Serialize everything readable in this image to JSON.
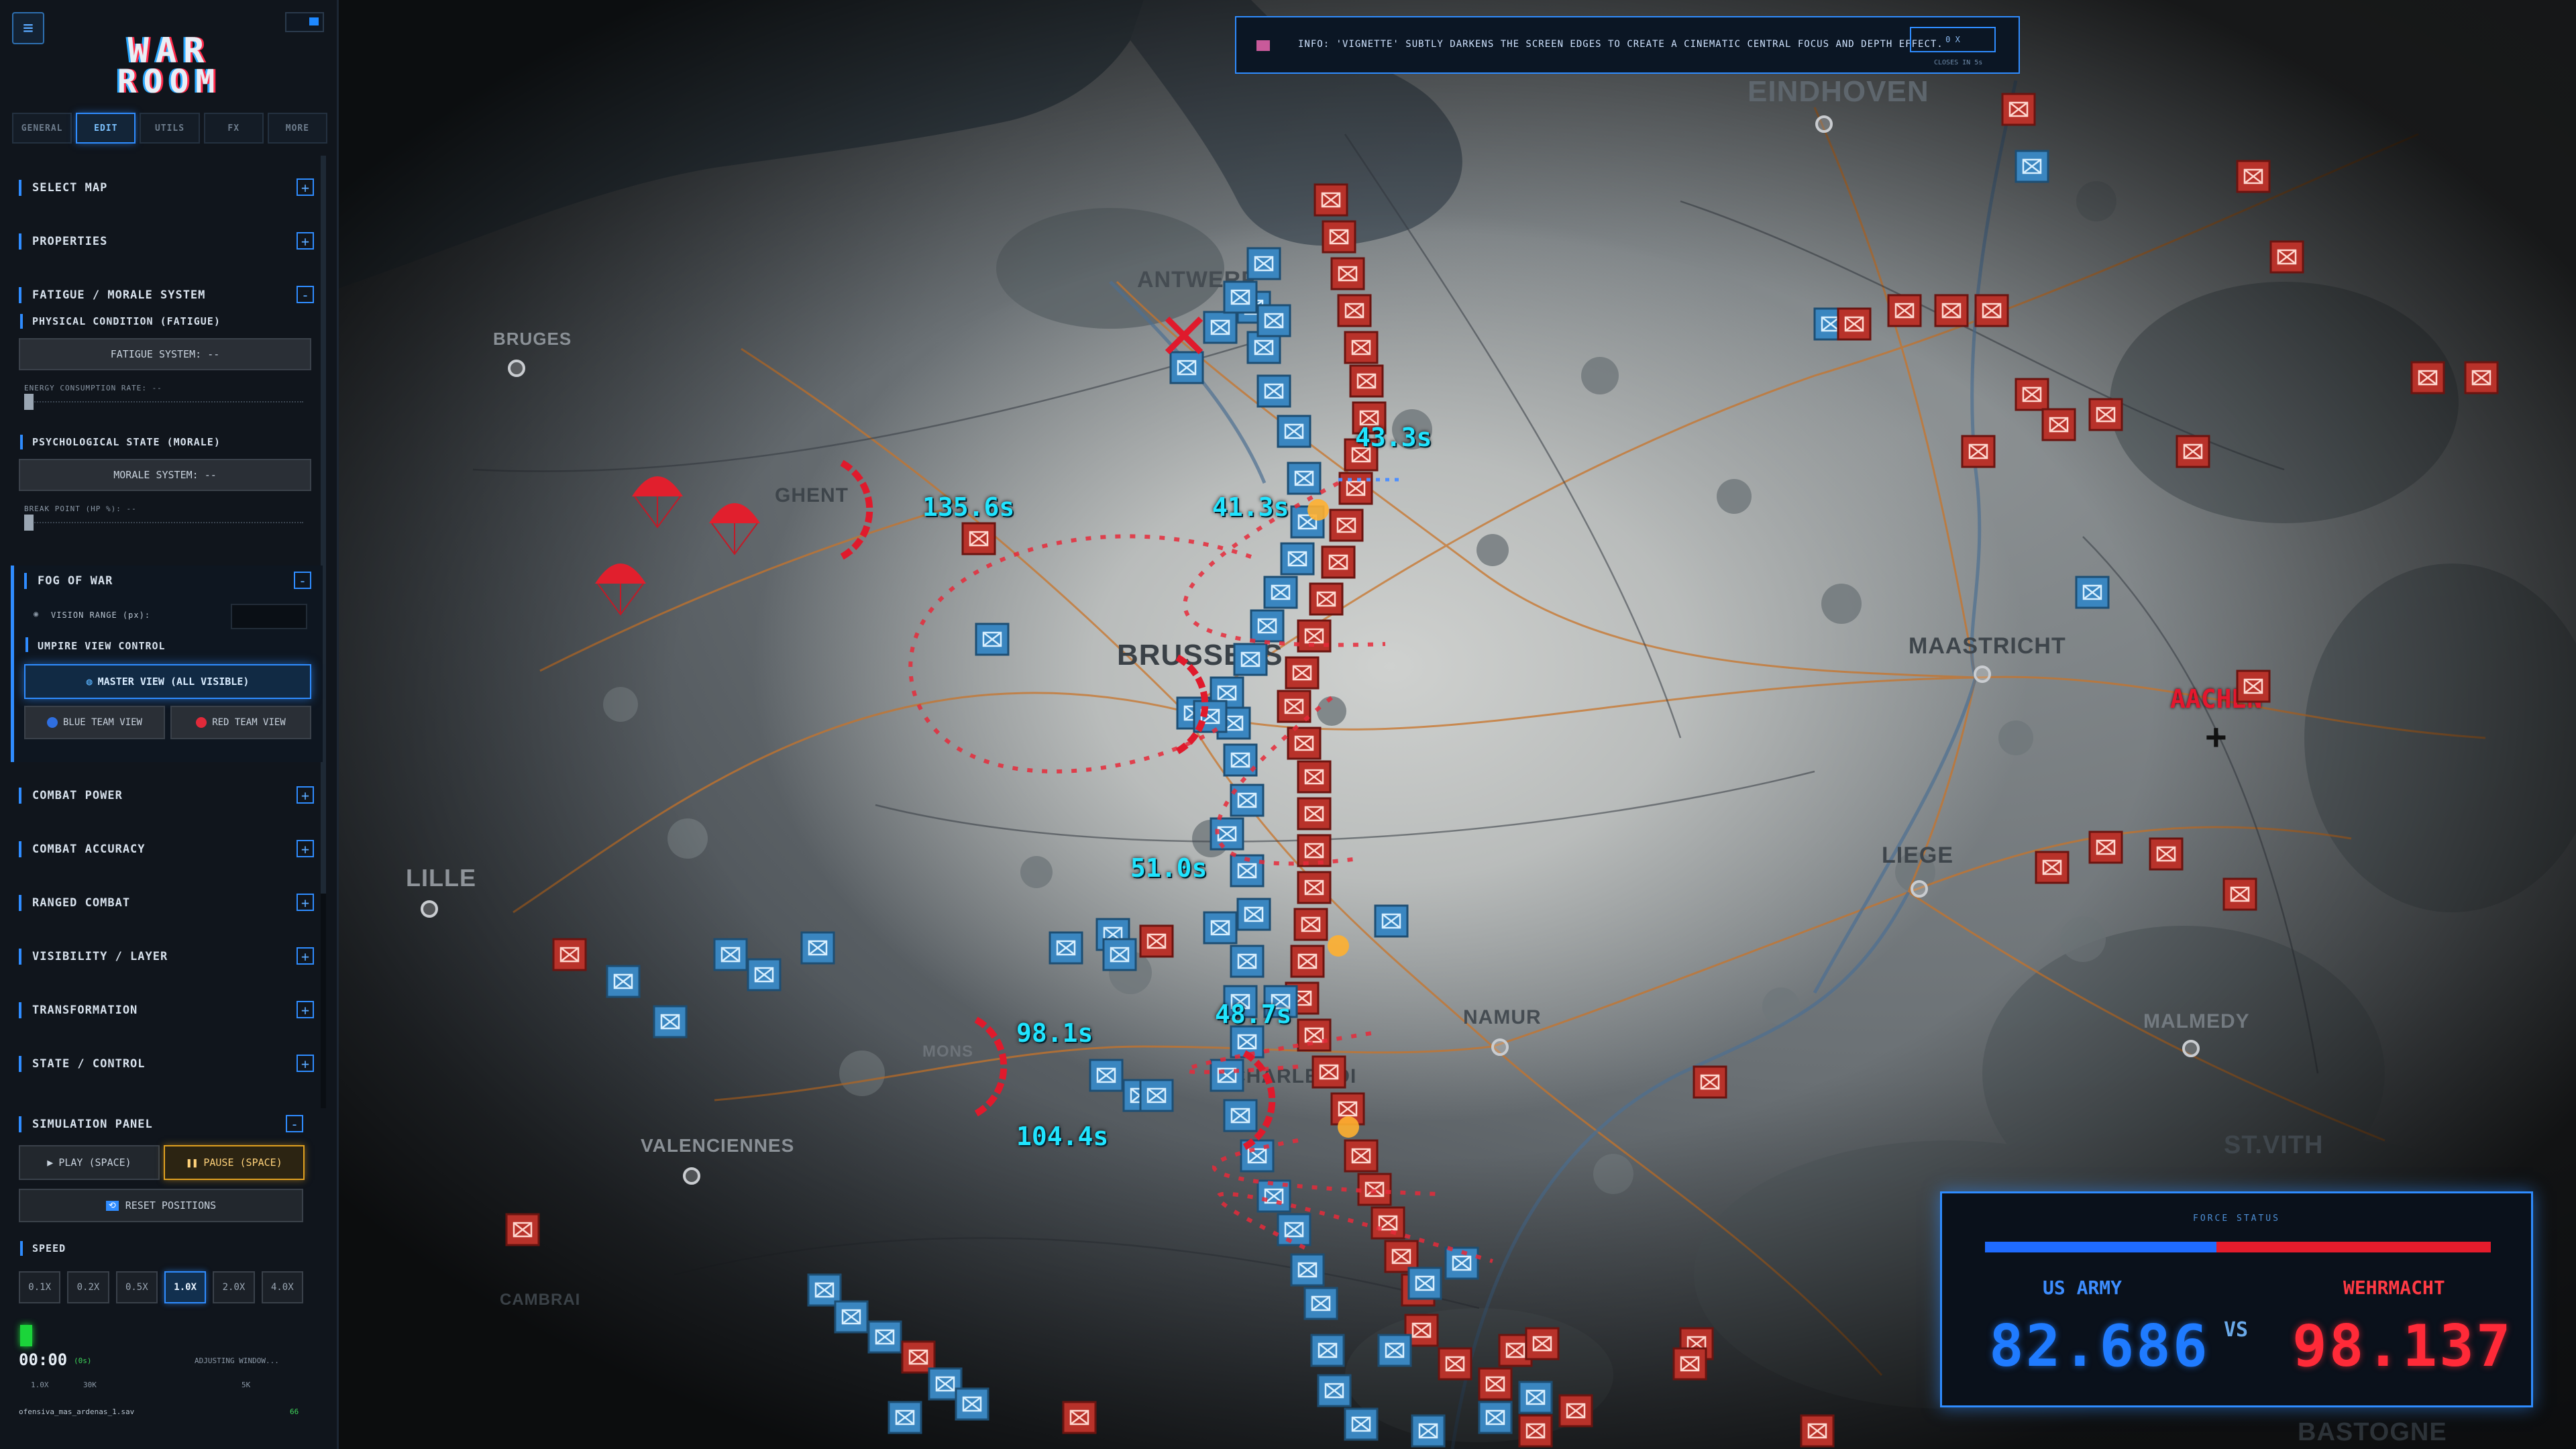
{
  "sidebar": {
    "logo_line1": "WAR",
    "logo_line2": "ROOM",
    "menu_icon": "hamburger-icon",
    "tabs": [
      "GENERAL",
      "EDIT",
      "UTILS",
      "FX",
      "MORE"
    ],
    "sections": {
      "select_map": "SELECT MAP",
      "properties": "PROPERTIES",
      "fatigue": "FATIGUE / MORALE SYSTEM",
      "combat_power": "COMBAT POWER",
      "combat_accuracy": "COMBAT ACCURACY",
      "ranged_combat": "RANGED COMBAT",
      "visibility": "VISIBILITY / LAYER",
      "transformation": "TRANSFORMATION",
      "state_control": "STATE / CONTROL",
      "simulation": "SIMULATION PANEL"
    },
    "plus": "+",
    "minus": "-",
    "physical_label": "PHYSICAL CONDITION (FATIGUE)",
    "fatigue_btn": "FATIGUE SYSTEM: --",
    "energy_label": "ENERGY CONSUMPTION RATE: --",
    "psych_label": "PSYCHOLOGICAL STATE (MORALE)",
    "morale_btn": "MORALE SYSTEM: --",
    "break_label": "BREAK POINT (HP %): --",
    "fog_title": "FOG OF WAR",
    "vision_label": "VISION RANGE (px):",
    "umpire_label": "UMPIRE VIEW CONTROL",
    "master_btn": "MASTER VIEW (ALL VISIBLE)",
    "blue_btn": "BLUE TEAM VIEW",
    "red_btn": "RED TEAM VIEW",
    "play_btn": "PLAY (SPACE)",
    "pause_btn": "PAUSE (SPACE)",
    "reset_btn": "RESET POSITIONS",
    "speed_label": "SPEED",
    "speeds": [
      "0.1X",
      "0.2X",
      "0.5X",
      "1.0X",
      "2.0X",
      "4.0X"
    ],
    "speed_selected": "1.0X",
    "timer": "00:00",
    "timer_sub": "(0s)",
    "timer_status": "ADJUSTING WINDOW...",
    "small_a": "1.0X",
    "small_b": "30K",
    "small_c": "5K",
    "filename": "ofensiva_mas_ardenas_1.sav",
    "fileval": "66"
  },
  "banner": {
    "text": "INFO: 'VIGNETTE' SUBTLY DARKENS THE SCREEN EDGES TO CREATE A CINEMATIC CENTRAL FOCUS AND DEPTH EFFECT.",
    "box": "0 X",
    "close": "CLOSES IN 5s"
  },
  "map": {
    "cities": [
      "EINDHOVEN",
      "ANTWERP",
      "BRUGES",
      "GHENT",
      "BRUSSELS",
      "MAASTRICHT",
      "AACHEN",
      "LILLE",
      "LIEGE",
      "NAMUR",
      "MONS",
      "VALENCIENNES",
      "MALMEDY",
      "ST.VITH",
      "CHARLEROI",
      "CAMBRAI",
      "BASTOGNE"
    ],
    "times": [
      "135.6s",
      "41.3s",
      "43.3s",
      "51.0s",
      "48.7s",
      "98.1s",
      "104.4s"
    ]
  },
  "force_status": {
    "title": "FORCE STATUS",
    "us_name": "US ARMY",
    "us_value": "82.686",
    "vs": "VS",
    "de_name": "WEHRMACHT",
    "de_value": "98.137",
    "us_share": 0.457,
    "us_color": "#1f6bff",
    "de_color": "#e41c2c"
  },
  "colors": {
    "accent": "#2f8cff",
    "allied_unit": "#3a86c0",
    "axis_unit": "#b8322a",
    "time_label": "#20e4ff"
  }
}
